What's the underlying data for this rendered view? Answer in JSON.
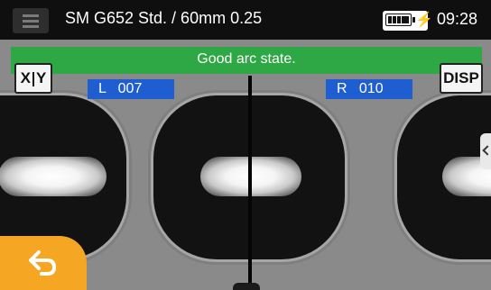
{
  "status_bar": {
    "title": "SM G652 Std. / 60mm 0.25",
    "time": "09:28",
    "battery_icon": "battery-charging-icon"
  },
  "message": {
    "text": "Good arc state."
  },
  "buttons": {
    "xy_label_x": "X",
    "xy_label_y": "Y",
    "disp_label": "DISP"
  },
  "counters": {
    "left": "L   007",
    "right": "R   010"
  },
  "colors": {
    "message_bar": "#2da845",
    "counter_bg": "#1f5ed1",
    "back_button": "#f5a623"
  }
}
